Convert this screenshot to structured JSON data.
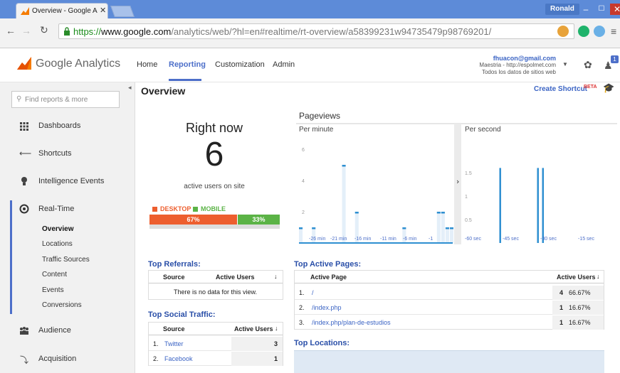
{
  "browser": {
    "tab_title": "Overview - Google Analyti",
    "user_badge": "Ronald",
    "url_scheme": "https://",
    "url_host": "www.google.com",
    "url_path": "/analytics/web/?hl=en#realtime/rt-overview/a58399231w94735479p98769201/"
  },
  "header": {
    "logo": "Google Analytics",
    "nav": [
      "Home",
      "Reporting",
      "Customization",
      "Admin"
    ],
    "active_nav": "Reporting",
    "account_email": "fhuacon@gmail.com",
    "account_property": "Maestria - http://espolmet.com",
    "account_view": "Todos los datos de sitios web",
    "notif_count": "1"
  },
  "sidebar": {
    "search_placeholder": "Find reports & more",
    "items": [
      {
        "label": "Dashboards",
        "icon": "grid-icon"
      },
      {
        "label": "Shortcuts",
        "icon": "arrow-icon"
      },
      {
        "label": "Intelligence Events",
        "icon": "bulb-icon"
      },
      {
        "label": "Real-Time",
        "icon": "realtime-icon"
      },
      {
        "label": "Audience",
        "icon": "people-icon"
      },
      {
        "label": "Acquisition",
        "icon": "acquisition-icon"
      }
    ],
    "realtime_sub": [
      "Overview",
      "Locations",
      "Traffic Sources",
      "Content",
      "Events",
      "Conversions"
    ]
  },
  "main": {
    "title": "Overview",
    "create_shortcut": "Create Shortcut",
    "beta": "BETA",
    "right_now": "Right now",
    "active_count": "6",
    "active_label": "active users on site",
    "device_split": {
      "desktop_label": "DESKTOP",
      "mobile_label": "MOBILE",
      "desktop_pct": "67%",
      "mobile_pct": "33%",
      "desktop_fraction": 0.67
    },
    "pageviews_title": "Pageviews",
    "per_minute_label": "Per minute",
    "per_second_label": "Per second",
    "top_referrals": {
      "title": "Top Referrals:",
      "col_source": "Source",
      "col_active": "Active Users",
      "empty": "There is no data for this view."
    },
    "top_social": {
      "title": "Top Social Traffic:",
      "col_source": "Source",
      "col_active": "Active Users",
      "rows": [
        {
          "n": "1.",
          "source": "Twitter",
          "users": "3"
        },
        {
          "n": "2.",
          "source": "Facebook",
          "users": "1"
        }
      ]
    },
    "top_pages": {
      "title": "Top Active Pages:",
      "col_page": "Active Page",
      "col_active": "Active Users",
      "rows": [
        {
          "n": "1.",
          "page": "/",
          "users": "4",
          "pct": "66.67%"
        },
        {
          "n": "2.",
          "page": "/index.php",
          "users": "1",
          "pct": "16.67%"
        },
        {
          "n": "3.",
          "page": "/index.php/plan-de-estudios",
          "users": "1",
          "pct": "16.67%"
        }
      ]
    },
    "top_locations": {
      "title": "Top Locations:"
    }
  },
  "colors": {
    "accent": "#4d6fc9",
    "desktop": "#ed5e2e",
    "mobile": "#5bb346",
    "chart": "#2e8fd1",
    "chart_fill": "#e4eff9"
  },
  "chart_data": [
    {
      "type": "bar",
      "title": "Per minute",
      "categories": [
        "-30",
        "-29",
        "-28",
        "-27",
        "-26",
        "-25",
        "-24",
        "-23",
        "-22",
        "-21",
        "-20",
        "-19",
        "-18",
        "-17",
        "-16",
        "-15",
        "-14",
        "-13",
        "-12",
        "-11",
        "-10",
        "-9",
        "-8",
        "-7",
        "-6",
        "-5",
        "-4",
        "-3",
        "-2",
        "-1"
      ],
      "values": [
        1,
        0,
        0,
        1,
        0,
        0,
        0,
        0,
        0,
        0,
        5,
        0,
        0,
        2,
        0,
        0,
        0,
        0,
        0,
        0,
        0,
        0,
        0,
        0,
        1,
        0,
        0,
        0,
        0,
        0,
        0,
        0,
        2,
        2,
        1,
        1
      ],
      "tick_labels": [
        "-26 min",
        "-21 min",
        "-16 min",
        "-11 min",
        "-6 min",
        "-1"
      ],
      "yticks": [
        "2",
        "4",
        "6"
      ],
      "ylim": [
        0,
        6
      ]
    },
    {
      "type": "bar",
      "title": "Per second",
      "values": [
        1.6,
        1.6,
        1.6
      ],
      "positions": [
        -46,
        -31,
        -29
      ],
      "tick_labels": [
        "-60 sec",
        "-45 sec",
        "-30 sec",
        "-15 sec"
      ],
      "yticks": [
        "0.5",
        "1",
        "1.5"
      ],
      "ylim": [
        0,
        2
      ]
    }
  ]
}
